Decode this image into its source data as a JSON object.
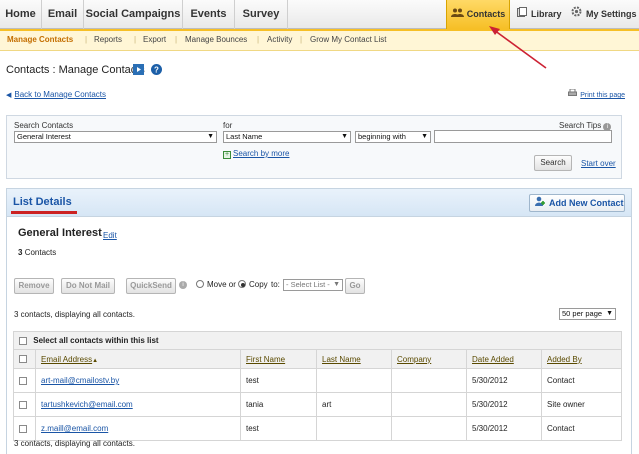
{
  "topnav": {
    "tabs": [
      {
        "label": "Home"
      },
      {
        "label": "Email"
      },
      {
        "label": "Social Campaigns"
      },
      {
        "label": "Events"
      },
      {
        "label": "Survey"
      }
    ],
    "contacts": "Contacts",
    "library": "Library",
    "settings": "My Settings"
  },
  "subnav": [
    "Manage Contacts",
    "Reports",
    "Export",
    "Manage Bounces",
    "Activity",
    "Grow My Contact List"
  ],
  "page_title": "Contacts : Manage Contacts",
  "back_link": "Back to Manage Contacts",
  "print_link": "Print this page",
  "search": {
    "search_contacts_label": "Search Contacts",
    "for_label": "for",
    "tips_label": "Search Tips",
    "list_value": "General Interest",
    "field_value": "Last Name",
    "operator_value": "beginning with",
    "query_value": "",
    "search_by_more": "Search by more",
    "search_button": "Search",
    "start_over": "Start over"
  },
  "list_details": {
    "title": "List Details",
    "add_new_contact": "Add New Contact",
    "list_name": "General Interest",
    "edit": "Edit",
    "count_number": "3",
    "count_text": "Contacts"
  },
  "actions": {
    "remove": "Remove",
    "do_not_mail": "Do Not Mail",
    "quicksend": "QuickSend",
    "move_or": "Move or",
    "copy": "Copy",
    "to": "to:",
    "select_list": "- Select List -",
    "go": "Go"
  },
  "summary_top": "3 contacts, displaying all contacts.",
  "summary_bottom": "3 contacts, displaying all contacts.",
  "per_page": "50 per page",
  "table": {
    "select_all": "Select all contacts within this list",
    "columns": [
      "Email Address",
      "First Name",
      "Last Name",
      "Company",
      "Date Added",
      "Added By"
    ],
    "rows": [
      {
        "email": "art-mail@cmailostv.by",
        "first": "test",
        "last": "",
        "company": "",
        "date": "5/30/2012",
        "added_by": "Contact"
      },
      {
        "email": "tartushkevich@email.com",
        "first": "tania",
        "last": "art",
        "company": "",
        "date": "5/30/2012",
        "added_by": "Site owner"
      },
      {
        "email": "z.maill@email.com",
        "first": "test",
        "last": "",
        "company": "",
        "date": "5/30/2012",
        "added_by": "Contact"
      }
    ]
  },
  "colors": {
    "accent": "#f6bf26",
    "link": "#1a55a6",
    "annotation_arrow": "#cc2233"
  }
}
